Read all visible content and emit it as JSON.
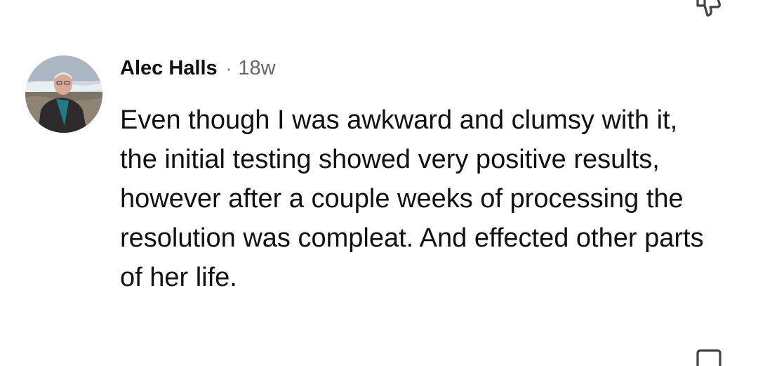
{
  "comment": {
    "author": "Alec Halls",
    "separator": "·",
    "age": "18w",
    "text": "Even though I was awkward and clumsy with it, the initial testing showed very positive results, however after a couple weeks of processing the resolution was compleat. And effected other parts of her life."
  },
  "icons": {
    "top_action": "dislike-icon",
    "bottom_action": "reply-icon"
  }
}
